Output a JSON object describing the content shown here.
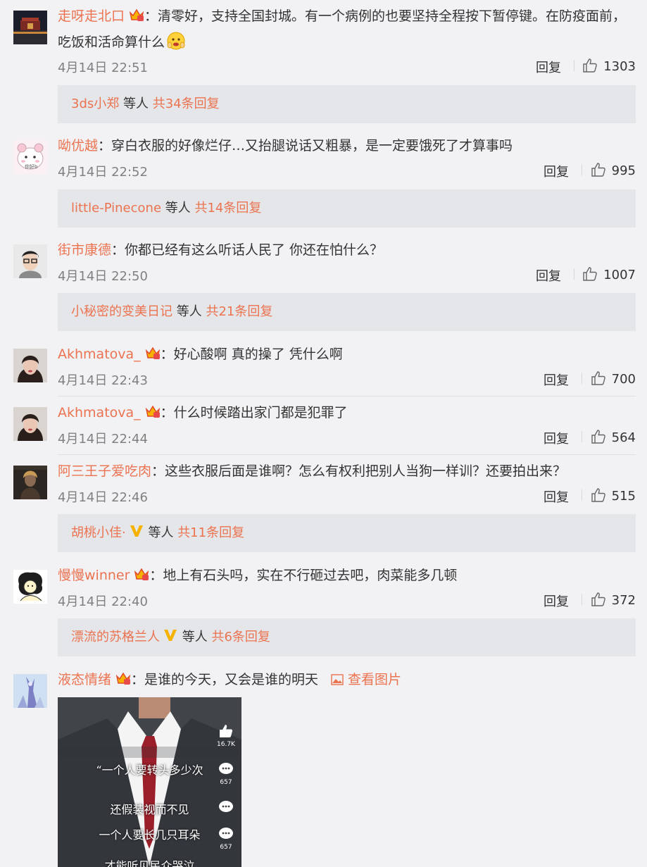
{
  "icons": {
    "crown": "vip-crown-icon",
    "verified": "verified-v-icon",
    "like": "thumbs-up-icon",
    "picture": "picture-icon"
  },
  "colors": {
    "username": "#eb7350",
    "background": "#f2f2f5",
    "reply_box": "#e5e6ea"
  },
  "comments": [
    {
      "user": "走呀走北口",
      "text_line1": "：清零好，支持全国封城。有一个病例的也要坚持全程按下暂停键。在防疫面前，",
      "text_line2": "吃饭和活命算什么",
      "time": "4月14日 22:51",
      "reply_label": "回复",
      "likes": "1303",
      "replies_user": "3ds小郑",
      "replies_mid": " 等人 ",
      "replies_count": "共34条回复"
    },
    {
      "user": "呦优越",
      "text": "：穿白衣服的好像烂仔…又抬腿说话又粗暴，是一定要饿死了才算事吗",
      "time": "4月14日 22:52",
      "reply_label": "回复",
      "likes": "995",
      "replies_user": "little-Pinecone",
      "replies_mid": " 等人 ",
      "replies_count": "共14条回复"
    },
    {
      "user": "街市康德",
      "text": "：你都已经有这么听话人民了 你还在怕什么？",
      "time": "4月14日 22:50",
      "reply_label": "回复",
      "likes": "1007",
      "replies_user": "小秘密的变美日记",
      "replies_mid": " 等人 ",
      "replies_count": "共21条回复"
    },
    {
      "user": "Akhmatova_",
      "text": "：好心酸啊 真的操了 凭什么啊",
      "time": "4月14日 22:43",
      "reply_label": "回复",
      "likes": "700"
    },
    {
      "user": "Akhmatova_",
      "text": "：什么时候踏出家门都是犯罪了",
      "time": "4月14日 22:44",
      "reply_label": "回复",
      "likes": "564"
    },
    {
      "user": "阿三王子爱吃肉",
      "text": "：这些衣服后面是谁啊？怎么有权利把别人当狗一样训？还要拍出来？",
      "time": "4月14日 22:46",
      "reply_label": "回复",
      "likes": "515",
      "replies_user": "胡桃小佳·",
      "replies_mid": " 等人 ",
      "replies_count": "共11条回复"
    },
    {
      "user": "慢慢winner",
      "text": "：地上有石头吗，实在不行砸过去吧，肉菜能多几顿",
      "time": "4月14日 22:40",
      "reply_label": "回复",
      "likes": "372",
      "replies_user": "漂流的苏格兰人",
      "replies_mid": " 等人 ",
      "replies_count": "共6条回复"
    },
    {
      "user": "液态情绪",
      "text": "：是谁的今天，又会是谁的明天",
      "view_pic": "查看图片",
      "photo_lines": [
        "“一个人要转头多少次",
        "还假装视而不见",
        "一个人要长几只耳朵",
        "才能听见民众哭泣"
      ],
      "photo_counts": [
        "16.7K",
        "657",
        "657"
      ]
    }
  ]
}
